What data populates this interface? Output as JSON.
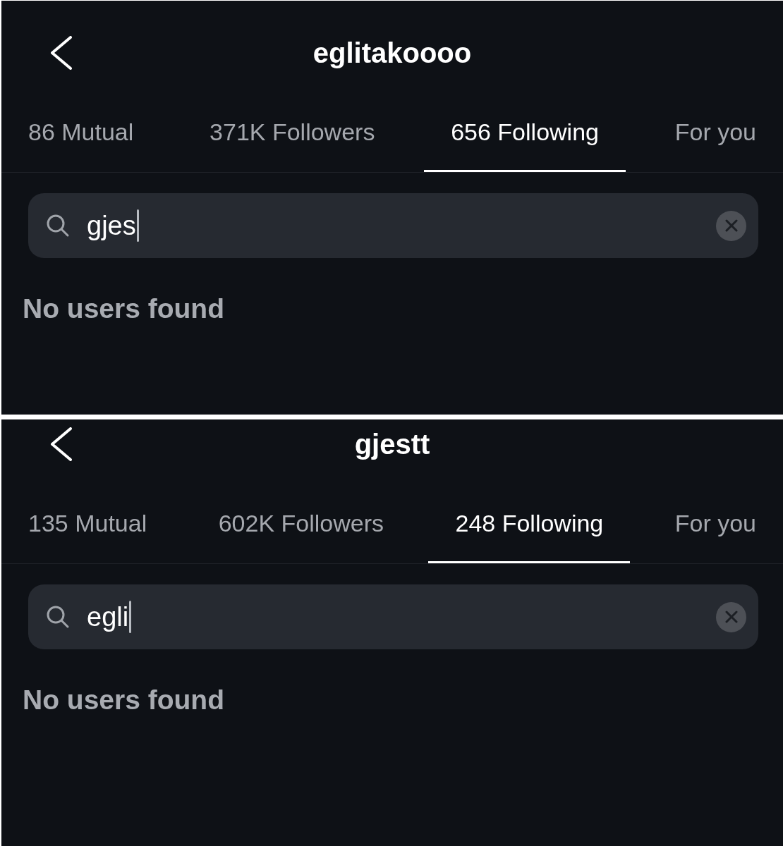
{
  "panels": [
    {
      "title": "eglitakoooo",
      "tabs": [
        {
          "label": "86 Mutual",
          "selected": false
        },
        {
          "label": "371K Followers",
          "selected": false
        },
        {
          "label": "656 Following",
          "selected": true
        },
        {
          "label": "For you",
          "selected": false
        }
      ],
      "search": {
        "value": "gjes"
      },
      "empty_message": "No users found"
    },
    {
      "title": "gjestt",
      "tabs": [
        {
          "label": "135 Mutual",
          "selected": false
        },
        {
          "label": "602K Followers",
          "selected": false
        },
        {
          "label": "248 Following",
          "selected": true
        },
        {
          "label": "For you",
          "selected": false
        }
      ],
      "search": {
        "value": "egli"
      },
      "empty_message": "No users found"
    }
  ]
}
